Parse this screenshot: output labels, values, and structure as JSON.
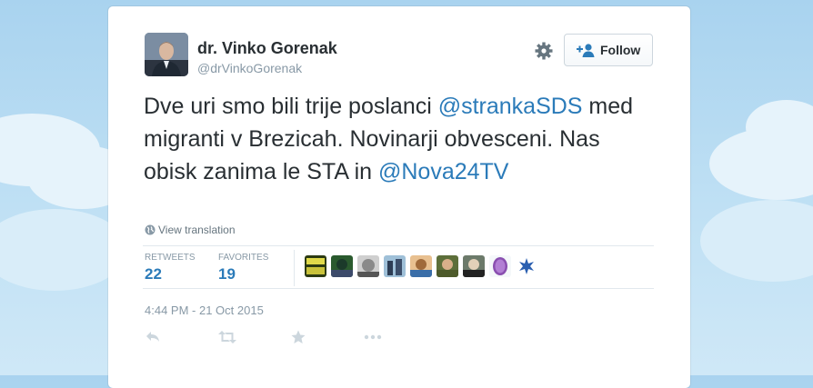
{
  "user": {
    "name": "dr. Vinko Gorenak",
    "handle": "@drVinkoGorenak"
  },
  "header": {
    "follow_label": "Follow"
  },
  "tweet": {
    "text_parts": [
      "Dve uri smo bili trije poslanci ",
      "@strankaSDS",
      " med migranti v Brezicah. Novinarji obvesceni.  Nas obisk zanima le STA in ",
      "@Nova24TV"
    ],
    "translate_label": "View translation",
    "timestamp": "4:44 PM - 21 Oct 2015"
  },
  "stats": {
    "retweets_label": "RETWEETS",
    "retweets_count": "22",
    "favorites_label": "FAVORITES",
    "favorites_count": "19"
  },
  "favoriters": [
    "favoriter-avatar-1",
    "favoriter-avatar-2",
    "favoriter-avatar-3",
    "favoriter-avatar-4",
    "favoriter-avatar-5",
    "favoriter-avatar-6",
    "favoriter-avatar-7",
    "favoriter-avatar-8",
    "favoriter-avatar-9"
  ],
  "actions": [
    "reply-icon",
    "retweet-icon",
    "favorite-icon",
    "more-icon"
  ],
  "colors": {
    "link": "#2b7bb9",
    "text": "#292f33",
    "muted": "#8899a6",
    "background": "#a9d3ef"
  }
}
